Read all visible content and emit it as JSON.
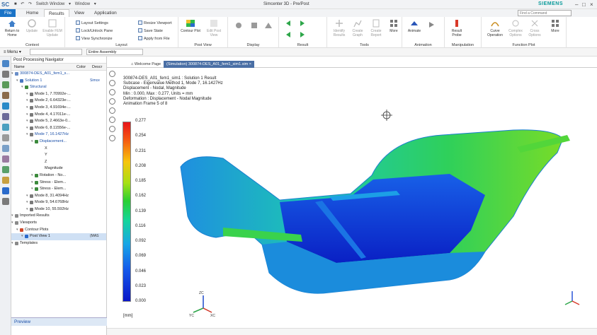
{
  "titlebar": {
    "logo": "SC",
    "switch_window": "Switch Window",
    "window_menu": "Window",
    "title": "Simcenter 3D - Pre/Post",
    "brand": "SIEMENS"
  },
  "tabs": [
    "File",
    "Home",
    "Results",
    "View",
    "Application"
  ],
  "active_tab": "Results",
  "search": {
    "placeholder": "Find a Command"
  },
  "ribbon": {
    "context": {
      "label": "Context",
      "buttons": [
        {
          "label": "Return to Home",
          "icon": "return-home-icon",
          "disabled": false
        },
        {
          "label": "Update",
          "icon": "update-icon",
          "disabled": true
        },
        {
          "label": "Enable FEM Update",
          "icon": "fem-update-icon",
          "disabled": true
        }
      ]
    },
    "layout": {
      "label": "Layout",
      "items": [
        "Layout Settings",
        "Lock/Unlock Pane",
        "View Synchronize"
      ],
      "items2": [
        "Resize Viewport",
        "Save State",
        "Apply from File"
      ]
    },
    "post_view": {
      "label": "Post View",
      "buttons": [
        {
          "label": "Contour Plot",
          "icon": "contour-plot-icon",
          "disabled": false
        },
        {
          "label": "Edit Post View",
          "icon": "edit-post-view-icon",
          "disabled": true
        }
      ]
    },
    "display": {
      "label": "Display"
    },
    "result": {
      "label": "Result"
    },
    "tools": {
      "label": "Tools",
      "buttons": [
        {
          "label": "Identify Results",
          "icon": "identify-results-icon",
          "disabled": true
        },
        {
          "label": "Create Graph",
          "icon": "create-graph-icon",
          "disabled": true
        },
        {
          "label": "Create Report",
          "icon": "create-report-icon",
          "disabled": true
        }
      ]
    },
    "more1": "More",
    "animation": {
      "label": "Animation",
      "buttons": [
        {
          "label": "Animate",
          "icon": "animate-icon",
          "disabled": false
        }
      ]
    },
    "manipulation": {
      "label": "Manipulation",
      "buttons": [
        {
          "label": "Result Probe",
          "icon": "result-probe-icon",
          "disabled": false
        }
      ]
    },
    "function_plot": {
      "label": "Function Plot",
      "buttons": [
        {
          "label": "Curve Operation",
          "icon": "curve-operation-icon",
          "disabled": false
        },
        {
          "label": "Complex Options",
          "icon": "complex-options-icon",
          "disabled": true
        },
        {
          "label": "Cross Options",
          "icon": "cross-options-icon",
          "disabled": true
        }
      ]
    },
    "more2": "More"
  },
  "cmdbar": {
    "menu": "Menu",
    "filter": "",
    "scope": "Entire Assembly"
  },
  "navigator": {
    "title": "Post Processing Navigator",
    "columns": [
      "Name",
      "Color",
      "Descr"
    ],
    "rows": [
      {
        "text": "300874-DES_A01_fem1_s...",
        "level": 0,
        "blue": true,
        "color": "#6a8fc8",
        "desc": ""
      },
      {
        "text": "Solution 1",
        "level": 1,
        "blue": true,
        "color": "#4a78c0",
        "desc": "Simce"
      },
      {
        "text": "Structural",
        "level": 2,
        "blue": true,
        "color": "#3c8a3c",
        "desc": ""
      },
      {
        "text": "Mode 1, 7.70992e-...",
        "level": 3,
        "blue": false,
        "color": "#7a7a7a",
        "desc": ""
      },
      {
        "text": "Mode 2, 6.64323e-...",
        "level": 3,
        "blue": false,
        "color": "#7a7a7a",
        "desc": ""
      },
      {
        "text": "Mode 3, 4.91694e-...",
        "level": 3,
        "blue": false,
        "color": "#7a7a7a",
        "desc": ""
      },
      {
        "text": "Mode 4, 4.17011e-...",
        "level": 3,
        "blue": false,
        "color": "#7a7a7a",
        "desc": ""
      },
      {
        "text": "Mode 5, 2.4663e-0...",
        "level": 3,
        "blue": false,
        "color": "#7a7a7a",
        "desc": ""
      },
      {
        "text": "Mode 6, 8.11556e-...",
        "level": 3,
        "blue": false,
        "color": "#7a7a7a",
        "desc": ""
      },
      {
        "text": "Mode 7, 16.1427Hz",
        "level": 3,
        "blue": true,
        "color": "#7a7a7a",
        "desc": ""
      },
      {
        "text": "Displacement...",
        "level": 4,
        "blue": true,
        "color": "#3c8a3c",
        "desc": ""
      },
      {
        "text": "X",
        "level": 5,
        "blue": false,
        "color": "",
        "desc": ""
      },
      {
        "text": "Y",
        "level": 5,
        "blue": false,
        "color": "",
        "desc": ""
      },
      {
        "text": "Z",
        "level": 5,
        "blue": false,
        "color": "",
        "desc": ""
      },
      {
        "text": "Magnitude",
        "level": 5,
        "blue": false,
        "color": "",
        "desc": ""
      },
      {
        "text": "Rotation - No...",
        "level": 4,
        "blue": false,
        "color": "#3c8a3c",
        "desc": ""
      },
      {
        "text": "Stress - Elem...",
        "level": 4,
        "blue": false,
        "color": "#3c8a3c",
        "desc": ""
      },
      {
        "text": "Stress - Elem...",
        "level": 4,
        "blue": false,
        "color": "#3c8a3c",
        "desc": ""
      },
      {
        "text": "Mode 8, 31.4094Hz",
        "level": 3,
        "blue": false,
        "color": "#7a7a7a",
        "desc": ""
      },
      {
        "text": "Mode 9, 54.6768Hz",
        "level": 3,
        "blue": false,
        "color": "#7a7a7a",
        "desc": ""
      },
      {
        "text": "Mode 10, 55.592Hz",
        "level": 3,
        "blue": false,
        "color": "#7a7a7a",
        "desc": ""
      },
      {
        "text": "Imported Results",
        "level": 0,
        "blue": false,
        "color": "#8a8a8a",
        "desc": ""
      },
      {
        "text": "Viewports",
        "level": 0,
        "blue": false,
        "color": "#8a8a8a",
        "desc": ""
      },
      {
        "text": "Contour Plots",
        "level": 1,
        "blue": false,
        "color": "#d04a2a",
        "desc": ""
      },
      {
        "text": "Post View 1",
        "level": 2,
        "blue": false,
        "color": "#2a6acb",
        "desc": "(MAS",
        "selected": true
      },
      {
        "text": "Templates",
        "level": 0,
        "blue": false,
        "color": "#8a8a8a",
        "desc": ""
      }
    ],
    "preview": "Preview"
  },
  "doc_tabs": [
    {
      "label": "Welcome Page",
      "active": false
    },
    {
      "label": "(Simulation) 300874-DES_A01_fem1_sim1.sim",
      "active": true
    }
  ],
  "viewport": {
    "info_lines": [
      "300874-DES_A01_fem1_sim1 : Solution 1 Result",
      "Subcase - Eigenvalue Method 1, Mode 7, 16.1427Hz",
      "Displacement - Nodal, Magnitude",
      "Min : 0.000, Max : 0.277, Units = mm",
      "Deformation : Displacement - Nodal Magnitude",
      "Animation Frame 5 of 8"
    ],
    "legend_values": [
      "0.277",
      "0.254",
      "0.231",
      "0.208",
      "0.185",
      "0.162",
      "0.139",
      "0.116",
      "0.092",
      "0.069",
      "0.046",
      "0.023",
      "0.000"
    ],
    "unit": "[mm]",
    "axis_labels": [
      "ZC",
      "YC",
      "XC"
    ]
  }
}
